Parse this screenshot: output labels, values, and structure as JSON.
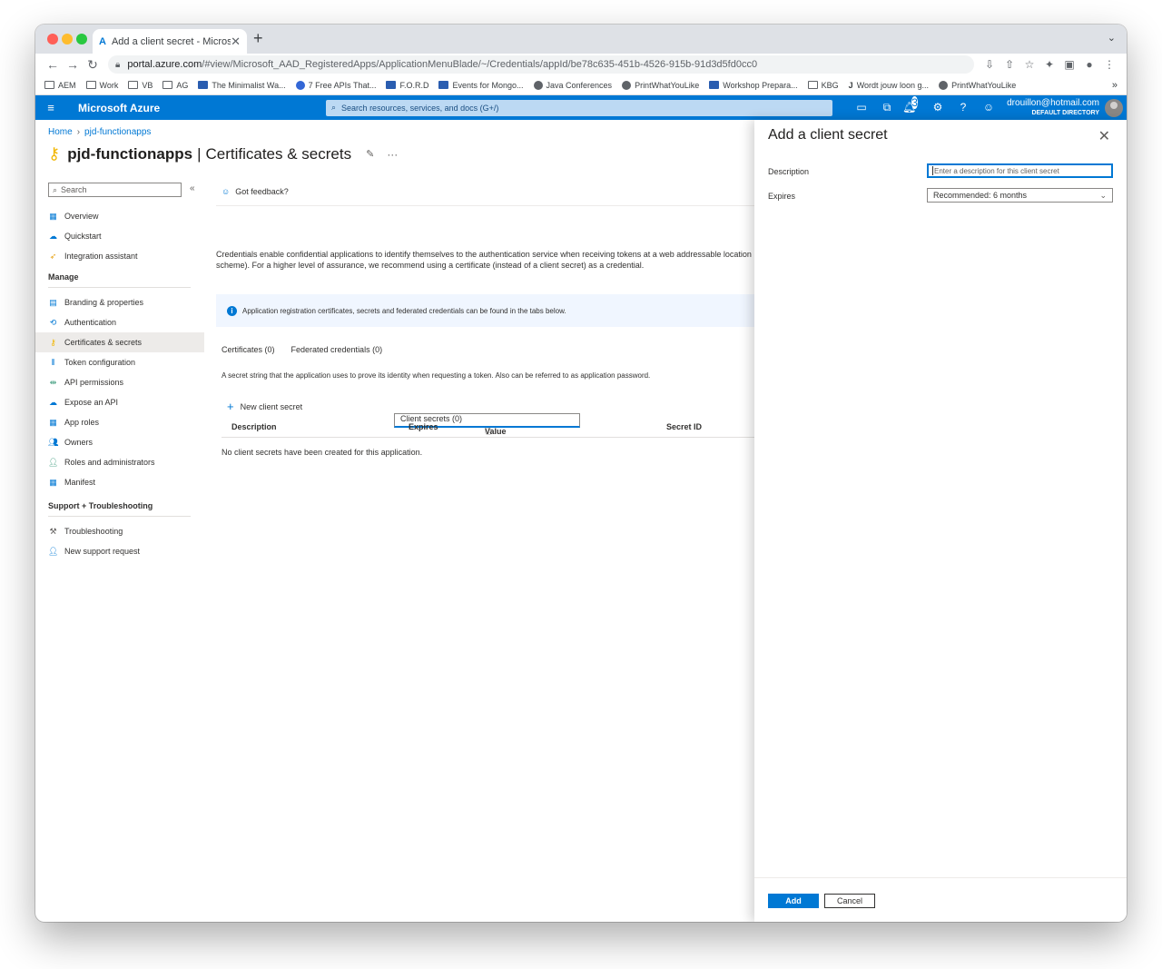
{
  "browser": {
    "tab_title": "Add a client secret - Microsoft",
    "url_host": "portal.azure.com",
    "url_path": "/#view/Microsoft_AAD_RegisteredApps/ApplicationMenuBlade/~/Credentials/appId/be78c635-451b-4526-915b-91d3d5fd0cc0",
    "bookmarks": [
      "AEM",
      "Work",
      "VB",
      "AG",
      "The Minimalist Wa...",
      "7 Free APIs That...",
      "F.O.R.D",
      "Events for Mongo...",
      "Java Conferences",
      "PrintWhatYouLike",
      "Workshop Prepara...",
      "KBG",
      "Wordt jouw loon g...",
      "PrintWhatYouLike"
    ],
    "colors": {
      "close": "#ff5f57",
      "minimize": "#febc2e",
      "maximize": "#28c840"
    }
  },
  "azure": {
    "brand": "Microsoft Azure",
    "search_placeholder": "Search resources, services, and docs (G+/)",
    "notifications_count": "3",
    "account_email": "drouillon@hotmail.com",
    "account_directory": "DEFAULT DIRECTORY",
    "accent": "#0078d4"
  },
  "breadcrumb": {
    "home": "Home",
    "app": "pjd-functionapps"
  },
  "page": {
    "app_name": "pjd-functionapps",
    "section": "Certificates & secrets"
  },
  "sidebar": {
    "search_placeholder": "Search",
    "items": [
      {
        "label": "Overview",
        "icon": "grid-icon"
      },
      {
        "label": "Quickstart",
        "icon": "cloud-icon"
      },
      {
        "label": "Integration assistant",
        "icon": "rocket-icon"
      }
    ],
    "manage_heading": "Manage",
    "manage": [
      {
        "label": "Branding & properties",
        "icon": "branding-icon"
      },
      {
        "label": "Authentication",
        "icon": "refresh-icon"
      },
      {
        "label": "Certificates & secrets",
        "icon": "key-icon"
      },
      {
        "label": "Token configuration",
        "icon": "bars-icon"
      },
      {
        "label": "API permissions",
        "icon": "api-icon"
      },
      {
        "label": "Expose an API",
        "icon": "cloud-icon"
      },
      {
        "label": "App roles",
        "icon": "grid-icon"
      },
      {
        "label": "Owners",
        "icon": "users-icon"
      },
      {
        "label": "Roles and administrators",
        "icon": "person-icon"
      },
      {
        "label": "Manifest",
        "icon": "grid-icon"
      }
    ],
    "support_heading": "Support + Troubleshooting",
    "support": [
      {
        "label": "Troubleshooting",
        "icon": "wrench-icon"
      },
      {
        "label": "New support request",
        "icon": "person-icon"
      }
    ]
  },
  "main": {
    "feedback": "Got feedback?",
    "description_line1": "Credentials enable confidential applications to identify themselves to the authentication service when receiving tokens at a web addressable location",
    "description_line2": "scheme). For a higher level of assurance, we recommend using a certificate (instead of a client secret) as a credential.",
    "info": "Application registration certificates, secrets and federated credentials can be found in the tabs below.",
    "tabs": [
      "Certificates (0)",
      "Client secrets (0)",
      "Federated credentials (0)"
    ],
    "tab_description": "A secret string that the application uses to prove its identity when requesting a token. Also can be referred to as application password.",
    "new_secret": "New client secret",
    "columns": [
      "Description",
      "Expires",
      "Value",
      "Secret ID"
    ],
    "empty": "No client secrets have been created for this application."
  },
  "panel": {
    "title": "Add a client secret",
    "description_label": "Description",
    "description_placeholder": "Enter a description for this client secret",
    "expires_label": "Expires",
    "expires_value": "Recommended: 6 months",
    "add": "Add",
    "cancel": "Cancel"
  }
}
